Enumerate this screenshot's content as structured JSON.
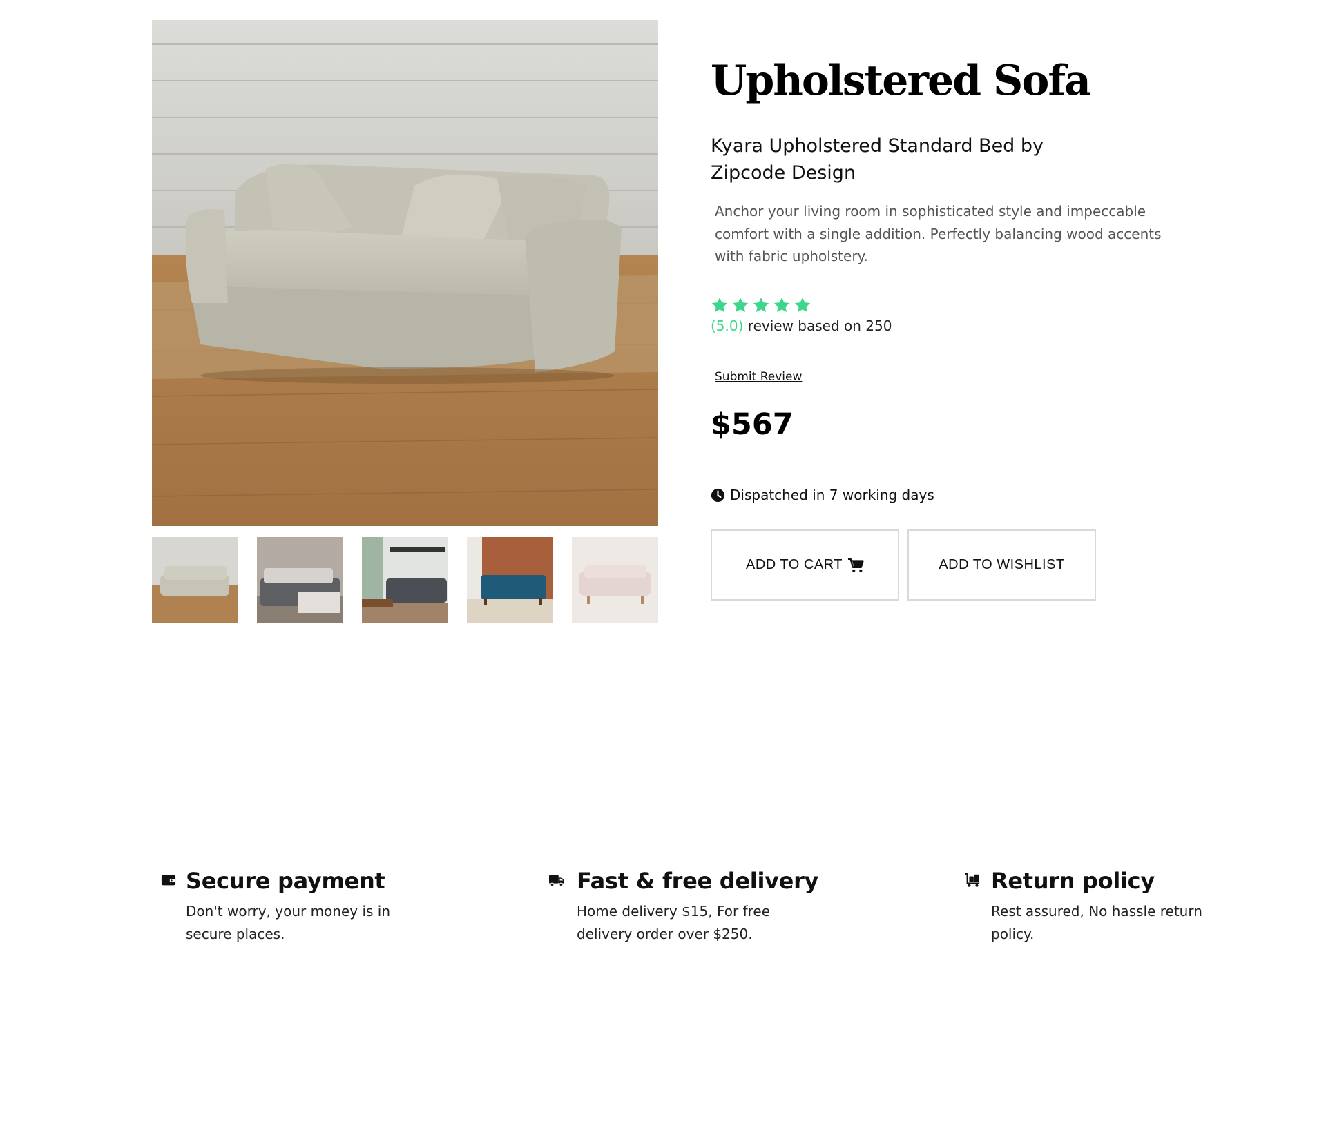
{
  "product": {
    "title": "Upholstered Sofa",
    "subtitle": "Kyara Upholstered Standard Bed by Zipcode Design",
    "description": "Anchor your living room in sophisticated style and impeccable comfort with a single addition. Perfectly balancing wood accents with fabric upholstery.",
    "rating": {
      "stars": 5,
      "score_text": "(5.0)",
      "review_text": " review based on 250",
      "submit_label": "Submit Review"
    },
    "price": "$567",
    "dispatch_text": "Dispatched in 7 working days"
  },
  "actions": {
    "add_to_cart_label": "ADD TO CART",
    "add_to_wishlist_label": "ADD TO WISHLIST"
  },
  "gallery": {
    "main_image": "beige-sofa-on-wood-floor",
    "thumbnails": [
      "beige-sofa",
      "grey-sectional-sofa",
      "dark-grey-sofa-living-room",
      "blue-tufted-sofa",
      "pink-tufted-sofa"
    ]
  },
  "features": [
    {
      "icon": "wallet-icon",
      "title": "Secure payment",
      "text": "Don't worry, your money is in secure places."
    },
    {
      "icon": "truck-icon",
      "title": "Fast & free delivery",
      "text": "Home delivery $15, For free delivery order over $250."
    },
    {
      "icon": "luggage-cart-icon",
      "title": "Return policy",
      "text": "Rest assured, No hassle return policy."
    }
  ],
  "colors": {
    "accent_green": "#3ed68b",
    "text_dark": "#111111",
    "text_muted": "#555555",
    "button_border": "#d9d9d9"
  }
}
